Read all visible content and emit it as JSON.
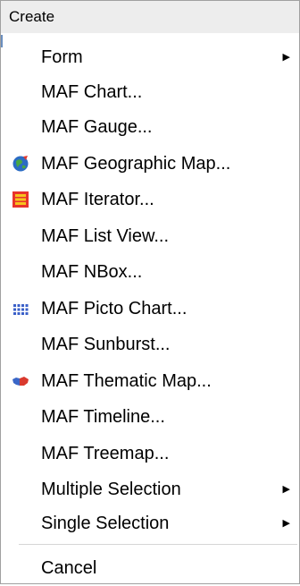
{
  "menu": {
    "header": "Create",
    "items": [
      {
        "key": "form",
        "label": "Form",
        "has_submenu": true,
        "icon": null
      },
      {
        "key": "chart",
        "label": "MAF Chart...",
        "has_submenu": false,
        "icon": null
      },
      {
        "key": "gauge",
        "label": "MAF Gauge...",
        "has_submenu": false,
        "icon": null
      },
      {
        "key": "geographic-map",
        "label": "MAF Geographic Map...",
        "has_submenu": false,
        "icon": "globe-icon"
      },
      {
        "key": "iterator",
        "label": "MAF Iterator...",
        "has_submenu": false,
        "icon": "iterator-icon"
      },
      {
        "key": "list-view",
        "label": "MAF List View...",
        "has_submenu": false,
        "icon": null
      },
      {
        "key": "nbox",
        "label": "MAF NBox...",
        "has_submenu": false,
        "icon": null
      },
      {
        "key": "picto-chart",
        "label": "MAF Picto Chart...",
        "has_submenu": false,
        "icon": "picto-grid-icon"
      },
      {
        "key": "sunburst",
        "label": "MAF Sunburst...",
        "has_submenu": false,
        "icon": null
      },
      {
        "key": "thematic-map",
        "label": "MAF Thematic Map...",
        "has_submenu": false,
        "icon": "thematic-map-icon"
      },
      {
        "key": "timeline",
        "label": "MAF Timeline...",
        "has_submenu": false,
        "icon": null
      },
      {
        "key": "treemap",
        "label": "MAF Treemap...",
        "has_submenu": false,
        "icon": null
      },
      {
        "key": "multiple-selection",
        "label": "Multiple Selection",
        "has_submenu": true,
        "icon": null
      },
      {
        "key": "single-selection",
        "label": "Single Selection",
        "has_submenu": true,
        "icon": null
      }
    ],
    "cancel_label": "Cancel"
  },
  "colors": {
    "header_bg": "#ededed",
    "border": "#a0a0a0",
    "separator": "#d6d6d6",
    "globe_blue": "#2b6cc4",
    "iterator_red": "#e8332b",
    "iterator_yellow": "#f7c21c",
    "picto_blue": "#3a5fc8",
    "thematic_blue": "#3a67c8",
    "thematic_red": "#d93a2e"
  },
  "submenu_arrow_glyph": "▶"
}
